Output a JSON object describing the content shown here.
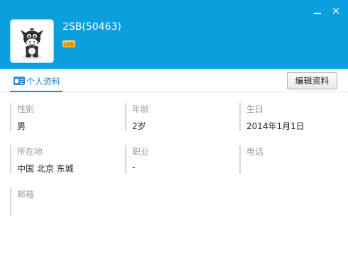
{
  "window": {
    "minimize_icon": "minimize-icon",
    "close_label": "×"
  },
  "profile": {
    "nickname": "2SB(50463)",
    "level_badge": "LV0",
    "avatar_icon": "cartoon-donkey-avatar"
  },
  "tabs": [
    {
      "label": "个人资料",
      "icon": "profile-card-icon",
      "active": true
    }
  ],
  "actions": {
    "edit_label": "编辑资料"
  },
  "fields": {
    "gender": {
      "label": "性别",
      "value": "男"
    },
    "age": {
      "label": "年龄",
      "value": "2岁"
    },
    "birthday": {
      "label": "生日",
      "value": "2014年1月1日"
    },
    "location": {
      "label": "所在地",
      "value": "中国 北京 东城"
    },
    "occupation": {
      "label": "职业",
      "value": "-"
    },
    "phone": {
      "label": "电话",
      "value": ""
    },
    "email": {
      "label": "邮箱",
      "value": ""
    }
  },
  "colors": {
    "header_bg": "#0c9fde",
    "accent": "#1a8ad6"
  }
}
